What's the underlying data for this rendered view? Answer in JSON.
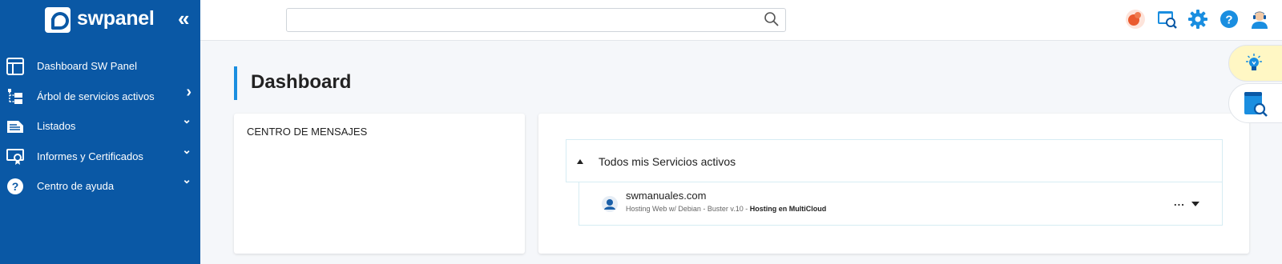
{
  "brand": {
    "name": "swpanel"
  },
  "sidebar": {
    "items": [
      {
        "label": "Dashboard SW Panel",
        "icon": "dashboard-icon",
        "chevron": ""
      },
      {
        "label": "Árbol de servicios activos",
        "icon": "tree-icon",
        "chevron": "›"
      },
      {
        "label": "Listados",
        "icon": "list-icon",
        "chevron": "⌄"
      },
      {
        "label": "Informes y Certificados",
        "icon": "certificate-icon",
        "chevron": "⌄"
      },
      {
        "label": "Centro de ayuda",
        "icon": "help-icon",
        "chevron": "⌄"
      }
    ]
  },
  "header": {
    "search": {
      "value": "",
      "placeholder": ""
    }
  },
  "main": {
    "title": "Dashboard",
    "messages_card": {
      "title": "CENTRO DE MENSAJES"
    },
    "services_card": {
      "panel_title": "Todos mis Servicios activos",
      "services": [
        {
          "domain": "swmanuales.com",
          "description": "Hosting Web w/ Debian - Buster v.10 - ",
          "type": "Hosting en MultiCloud",
          "more": "..."
        }
      ]
    }
  },
  "colors": {
    "sidebar_bg": "#0a58a5",
    "accent": "#1a8ee0",
    "tip_bg": "#fff7c4"
  }
}
